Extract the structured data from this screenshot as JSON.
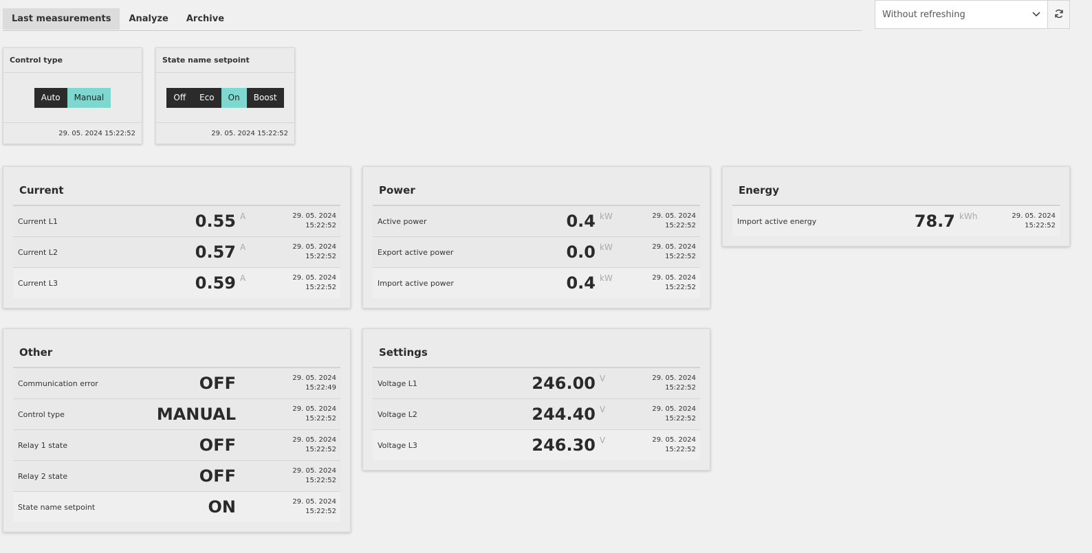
{
  "tabs": [
    {
      "label": "Last measurements",
      "active": true
    },
    {
      "label": "Analyze",
      "active": false
    },
    {
      "label": "Archive",
      "active": false
    }
  ],
  "refresh": {
    "selected": "Without refreshing",
    "icon": "refresh-icon"
  },
  "control_cards": [
    {
      "title": "Control type",
      "options": [
        "Auto",
        "Manual"
      ],
      "active": "Manual",
      "timestamp": "29. 05. 2024 15:22:52"
    },
    {
      "title": "State name setpoint",
      "options": [
        "Off",
        "Eco",
        "On",
        "Boost"
      ],
      "active": "On",
      "timestamp": "29. 05. 2024 15:22:52"
    }
  ],
  "cards": {
    "current": {
      "title": "Current",
      "rows": [
        {
          "label": "Current L1",
          "value": "0.55",
          "unit": "A",
          "date": "29. 05. 2024",
          "time": "15:22:52"
        },
        {
          "label": "Current L2",
          "value": "0.57",
          "unit": "A",
          "date": "29. 05. 2024",
          "time": "15:22:52"
        },
        {
          "label": "Current L3",
          "value": "0.59",
          "unit": "A",
          "date": "29. 05. 2024",
          "time": "15:22:52"
        }
      ]
    },
    "power": {
      "title": "Power",
      "rows": [
        {
          "label": "Active power",
          "value": "0.4",
          "unit": "kW",
          "date": "29. 05. 2024",
          "time": "15:22:52"
        },
        {
          "label": "Export active power",
          "value": "0.0",
          "unit": "kW",
          "date": "29. 05. 2024",
          "time": "15:22:52"
        },
        {
          "label": "Import active power",
          "value": "0.4",
          "unit": "kW",
          "date": "29. 05. 2024",
          "time": "15:22:52"
        }
      ]
    },
    "energy": {
      "title": "Energy",
      "rows": [
        {
          "label": "Import active energy",
          "value": "78.7",
          "unit": "kWh",
          "date": "29. 05. 2024",
          "time": "15:22:52"
        }
      ]
    },
    "other": {
      "title": "Other",
      "rows": [
        {
          "label": "Communication error",
          "value": "OFF",
          "unit": "",
          "date": "29. 05. 2024",
          "time": "15:22:49"
        },
        {
          "label": "Control type",
          "value": "MANUAL",
          "unit": "",
          "date": "29. 05. 2024",
          "time": "15:22:52"
        },
        {
          "label": "Relay 1 state",
          "value": "OFF",
          "unit": "",
          "date": "29. 05. 2024",
          "time": "15:22:52"
        },
        {
          "label": "Relay 2 state",
          "value": "OFF",
          "unit": "",
          "date": "29. 05. 2024",
          "time": "15:22:52"
        },
        {
          "label": "State name setpoint",
          "value": "ON",
          "unit": "",
          "date": "29. 05. 2024",
          "time": "15:22:52"
        }
      ]
    },
    "settings": {
      "title": "Settings",
      "rows": [
        {
          "label": "Voltage L1",
          "value": "246.00",
          "unit": "V",
          "date": "29. 05. 2024",
          "time": "15:22:52"
        },
        {
          "label": "Voltage L2",
          "value": "244.40",
          "unit": "V",
          "date": "29. 05. 2024",
          "time": "15:22:52"
        },
        {
          "label": "Voltage L3",
          "value": "246.30",
          "unit": "V",
          "date": "29. 05. 2024",
          "time": "15:22:52"
        }
      ]
    }
  }
}
